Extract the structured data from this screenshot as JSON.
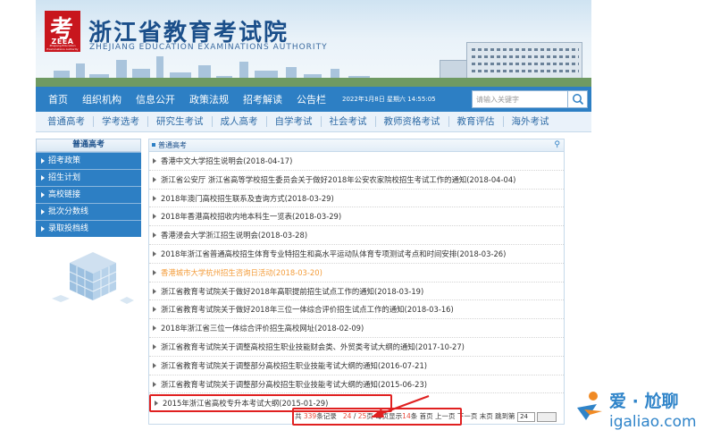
{
  "header": {
    "logo_glyph": "考",
    "logo_abbr": "ZEEA",
    "logo_tiny": "Zhejiang Education Examinations Authority",
    "title": "浙江省教育考试院",
    "subtitle": "ZHEJIANG EDUCATION EXAMINATIONS AUTHORITY"
  },
  "mainnav": {
    "items": [
      "首页",
      "组织机构",
      "信息公开",
      "政策法规",
      "招考解读",
      "公告栏"
    ],
    "datetime": "2022年1月8日 星期六 14:55:05",
    "search_placeholder": "请输入关键字"
  },
  "subnav": {
    "items": [
      "普通高考",
      "学考选考",
      "研究生考试",
      "成人高考",
      "自学考试",
      "社会考试",
      "教师资格考试",
      "教育评估",
      "海外考试"
    ]
  },
  "sidebar": {
    "title": "普通高考",
    "items": [
      "招考政策",
      "招生计划",
      "高校链接",
      "批次分数线",
      "录取投档线"
    ]
  },
  "content": {
    "section_title": "普通高考",
    "items": [
      "香港中文大学招生说明会(2018-04-17)",
      "浙江省公安厅 浙江省高等学校招生委员会关于做好2018年公安农家院校招生考试工作的通知(2018-04-04)",
      "2018年澳门高校招生联系及查询方式(2018-03-29)",
      "2018年香港高校招收内地本科生一览表(2018-03-29)",
      "香港浸会大学浙江招生说明会(2018-03-28)",
      "2018年浙江省普通高校招生体育专业特招生和高水平运动队体育专项测试考点和时间安排(2018-03-26)",
      "香港城市大学杭州招生咨询日活动(2018-03-20)",
      "浙江省教育考试院关于做好2018年高职提前招生试点工作的通知(2018-03-19)",
      "浙江省教育考试院关于做好2018年三位一体综合评价招生试点工作的通知(2018-03-16)",
      "2018年浙江省三位一体综合评价招生高校网址(2018-02-09)",
      "浙江省教育考试院关于调整高校招生职业技能财会类、外贸类考试大纲的通知(2017-10-27)",
      "浙江省教育考试院关于调整部分高校招生职业技能考试大纲的通知(2016-07-21)",
      "浙江省教育考试院关于调整部分高校招生职业技能考试大纲的通知(2015-06-23)",
      "2015年浙江省高校专升本考试大纲(2015-01-29)"
    ]
  },
  "pager": {
    "total_prefix": "共",
    "total": "339",
    "total_suffix": "条记录",
    "current": "24",
    "sep": "/",
    "pages": "25",
    "pages_suffix": "页",
    "per_page_prefix": "每页显示",
    "per_page": "14",
    "per_page_suffix": "条",
    "first": "首页",
    "prev": "上一页",
    "next": "下一页",
    "last": "末页",
    "jump_label": "跳到第",
    "jump_value": "24"
  },
  "watermark": {
    "cn": "爱 · 尬聊",
    "en": "igaliao.com"
  },
  "colors": {
    "nav_blue": "#2d7fc4",
    "title_blue": "#1b4f8a",
    "highlight_red": "#e02020",
    "pager_red": "#e84b3c",
    "orange_link": "#f39c3a"
  }
}
